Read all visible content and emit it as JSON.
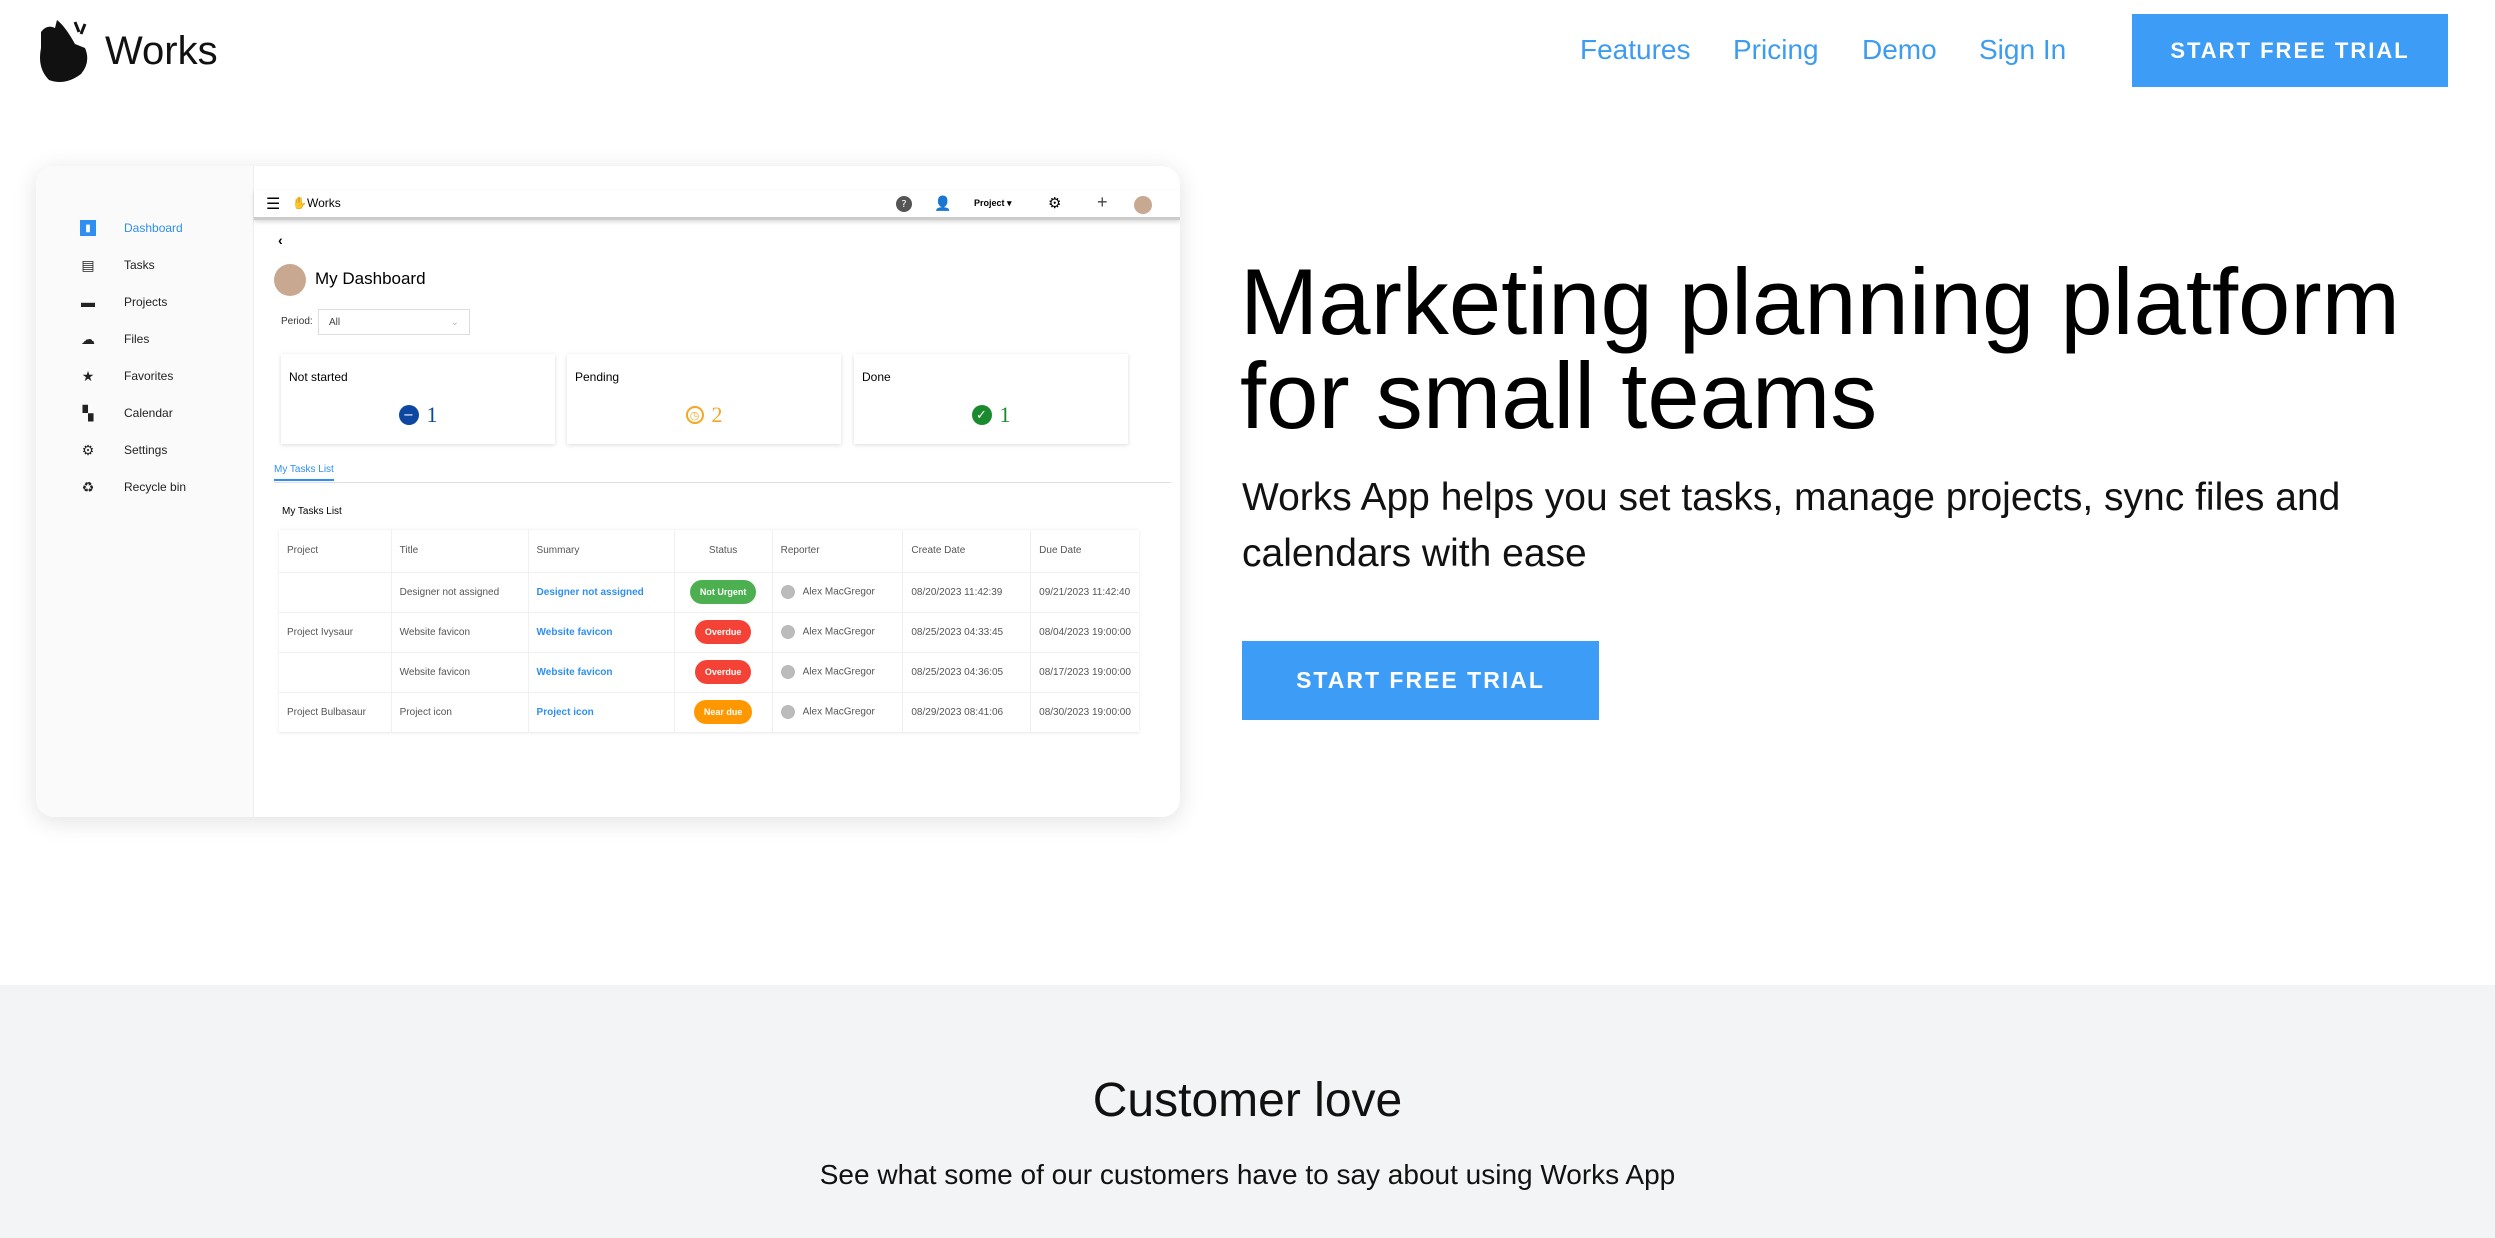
{
  "nav": {
    "brand": "Works",
    "links": [
      "Features",
      "Pricing",
      "Demo",
      "Sign In"
    ],
    "cta": "START FREE TRIAL"
  },
  "hero": {
    "title_line1": "Marketing planning platform",
    "title_line2": "for small teams",
    "subtitle_line1": "Works App helps you set tasks, manage projects, sync files and",
    "subtitle_line2": "calendars with ease",
    "cta": "START FREE TRIAL"
  },
  "app": {
    "brand": "Works",
    "project_menu": "Project",
    "sidebar": [
      {
        "label": "Dashboard",
        "icon": "bar-chart"
      },
      {
        "label": "Tasks",
        "icon": "tasks"
      },
      {
        "label": "Projects",
        "icon": "projects"
      },
      {
        "label": "Files",
        "icon": "cloud"
      },
      {
        "label": "Favorites",
        "icon": "star"
      },
      {
        "label": "Calendar",
        "icon": "calendar"
      },
      {
        "label": "Settings",
        "icon": "gear"
      },
      {
        "label": "Recycle bin",
        "icon": "recycle"
      }
    ],
    "page_title": "My Dashboard",
    "period_label": "Period:",
    "period_value": "All",
    "cards": [
      {
        "title": "Not started",
        "value": "1",
        "color": "#0d47a1",
        "icon": "minus-circle"
      },
      {
        "title": "Pending",
        "value": "2",
        "color": "#f5a623",
        "icon": "clock"
      },
      {
        "title": "Done",
        "value": "1",
        "color": "#1b8a2f",
        "icon": "check-circle"
      }
    ],
    "tab": "My Tasks List",
    "section_title": "My Tasks List",
    "columns": [
      "Project",
      "Title",
      "Summary",
      "Status",
      "Reporter",
      "Create Date",
      "Due Date"
    ],
    "rows": [
      {
        "project": "",
        "title": "Designer not assigned",
        "summary": "Designer not assigned",
        "status": "Not Urgent",
        "status_color": "#4caf50",
        "reporter": "Alex MacGregor",
        "created": "08/20/2023 11:42:39",
        "due": "09/21/2023 11:42:40"
      },
      {
        "project": "Project Ivysaur",
        "title": "Website favicon",
        "summary": "Website favicon",
        "status": "Overdue",
        "status_color": "#f44336",
        "reporter": "Alex MacGregor",
        "created": "08/25/2023 04:33:45",
        "due": "08/04/2023 19:00:00"
      },
      {
        "project": "",
        "title": "Website favicon",
        "summary": "Website favicon",
        "status": "Overdue",
        "status_color": "#f44336",
        "reporter": "Alex MacGregor",
        "created": "08/25/2023 04:36:05",
        "due": "08/17/2023 19:00:00"
      },
      {
        "project": "Project Bulbasaur",
        "title": "Project icon",
        "summary": "Project icon",
        "status": "Near due",
        "status_color": "#ff9800",
        "reporter": "Alex MacGregor",
        "created": "08/29/2023 08:41:06",
        "due": "08/30/2023 19:00:00"
      }
    ]
  },
  "customers": {
    "title": "Customer love",
    "subtitle": "See what some of our customers have to say about using Works App"
  }
}
